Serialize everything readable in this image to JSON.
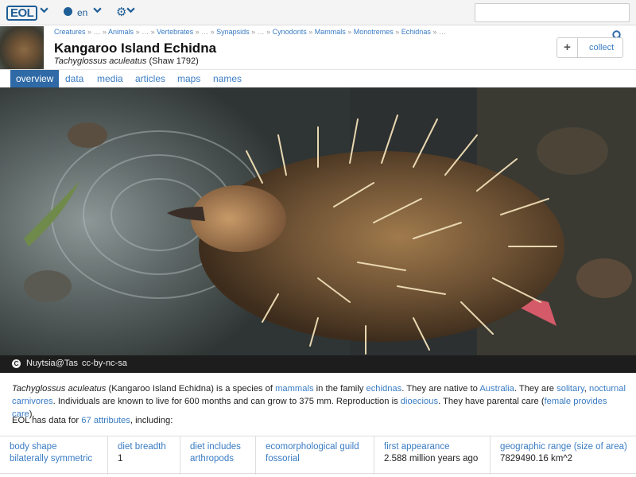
{
  "topbar": {
    "logo": "EOL",
    "language": "en"
  },
  "breadcrumb": [
    {
      "label": "Creatures",
      "link": true
    },
    {
      "label": " » … » ",
      "link": false
    },
    {
      "label": "Animals",
      "link": true
    },
    {
      "label": " » … » ",
      "link": false
    },
    {
      "label": "Vertebrates",
      "link": true
    },
    {
      "label": " » … » ",
      "link": false
    },
    {
      "label": "Synapsids",
      "link": true
    },
    {
      "label": " » … » ",
      "link": false
    },
    {
      "label": "Cynodonts",
      "link": true
    },
    {
      "label": " » ",
      "link": false
    },
    {
      "label": "Mammals",
      "link": true
    },
    {
      "label": " » ",
      "link": false
    },
    {
      "label": "Monotremes",
      "link": true
    },
    {
      "label": " » ",
      "link": false
    },
    {
      "label": "Echidnas",
      "link": true
    },
    {
      "label": " » …",
      "link": false
    }
  ],
  "header": {
    "title": "Kangaroo Island Echidna",
    "scientific_name": "Tachyglossus aculeatus",
    "authority": "(Shaw 1792)",
    "collect_label": "collect",
    "plus": "+"
  },
  "tabs": [
    {
      "label": "overview",
      "active": true
    },
    {
      "label": "data",
      "active": false
    },
    {
      "label": "media",
      "active": false
    },
    {
      "label": "articles",
      "active": false
    },
    {
      "label": "maps",
      "active": false
    },
    {
      "label": "names",
      "active": false
    }
  ],
  "image_credit": {
    "icon": "C",
    "author": "Nuytsia@Tas",
    "license": "cc-by-nc-sa"
  },
  "summary": [
    {
      "t": "Tachyglossus aculeatus",
      "s": "i"
    },
    {
      "t": " (Kangaroo Island Echidna) is a species of ",
      "s": ""
    },
    {
      "t": "mammals",
      "s": "a"
    },
    {
      "t": " in the family ",
      "s": ""
    },
    {
      "t": "echidnas",
      "s": "a"
    },
    {
      "t": ". They are native to ",
      "s": ""
    },
    {
      "t": "Australia",
      "s": "a"
    },
    {
      "t": ". They are ",
      "s": ""
    },
    {
      "t": "solitary",
      "s": "a"
    },
    {
      "t": ", ",
      "s": ""
    },
    {
      "t": "nocturnal carnivores",
      "s": "a"
    },
    {
      "t": ". Individuals are known to live for 600 months and can grow to 375 mm. Reproduction is ",
      "s": ""
    },
    {
      "t": "dioecious",
      "s": "a"
    },
    {
      "t": ". They have parental care (",
      "s": ""
    },
    {
      "t": "female provides care",
      "s": "a"
    },
    {
      "t": ").",
      "s": ""
    }
  ],
  "data_count": {
    "prefix": "EOL has data for ",
    "link": "67 attributes",
    "suffix": ", including:"
  },
  "traits": [
    {
      "key": "body shape",
      "value": "bilaterally symmetric",
      "value_link": true
    },
    {
      "key": "diet breadth",
      "value": "1",
      "value_link": false
    },
    {
      "key": "diet includes",
      "value": "arthropods",
      "value_link": true
    },
    {
      "key": "ecomorphological guild",
      "value": "fossorial",
      "value_link": true
    },
    {
      "key": "first appearance",
      "value": "2.588 million years ago",
      "value_link": false
    },
    {
      "key": "geographic range (size of area)",
      "value": "7829490.16 km^2",
      "value_link": false
    }
  ],
  "colors": {
    "link": "#3a7cc4",
    "active_tab": "#2f6aa6",
    "credit_bar": "#1d1d1d"
  },
  "icons": {
    "logo": "eol-logo",
    "globe": "globe-icon",
    "gear": "gear-icon",
    "search": "search-icon",
    "license": "copyright-icon"
  }
}
